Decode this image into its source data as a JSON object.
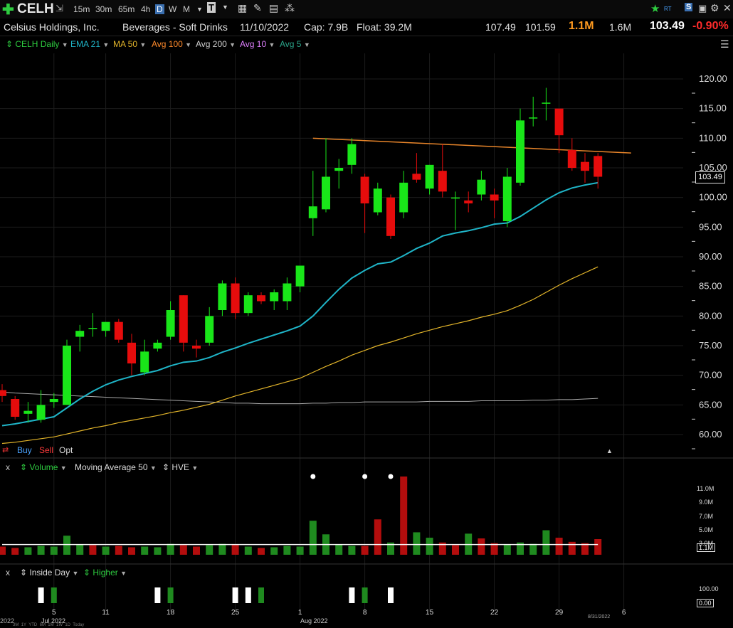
{
  "toolbar": {
    "plus_icon": "plus-icon",
    "symbol": "CELH",
    "timeframes": [
      "15m",
      "30m",
      "65m",
      "4h",
      "D",
      "W",
      "M"
    ],
    "active_timeframe": "D",
    "right_labels": [
      "RT"
    ]
  },
  "info": {
    "company": "Celsius Holdings, Inc.",
    "industry": "Beverages - Soft Drinks",
    "date": "11/10/2022",
    "cap": "Cap: 7.9B",
    "float": "Float: 39.2M",
    "high": "107.49",
    "low": "101.59",
    "volume": "1.1M",
    "avg_volume": "1.6M",
    "last": "103.49",
    "change": "-0.90%"
  },
  "indicators": {
    "symbol_label": "CELH Daily",
    "ema21": "EMA 21",
    "ma50": "MA 50",
    "avg100": "Avg 100",
    "avg200": "Avg 200",
    "avg10": "Avg 10",
    "avg5": "Avg 5"
  },
  "trade": {
    "buy": "Buy",
    "sell": "Sell",
    "opt": "Opt"
  },
  "volume_panel": {
    "close": "x",
    "label": "Volume",
    "ma_label": "Moving Average 50",
    "hve": "HVE",
    "ticks": [
      "11.0M",
      "9.0M",
      "7.0M",
      "5.0M",
      "3.0M"
    ],
    "current": "1.1M"
  },
  "inside_panel": {
    "close": "x",
    "label": "Inside Day",
    "higher": "Higher",
    "ticks": [
      "100.00"
    ],
    "current": "0.00"
  },
  "xaxis": {
    "dates": [
      "5",
      "11",
      "18",
      "25",
      "1",
      "8",
      "15",
      "22",
      "29",
      "6"
    ],
    "months": [
      {
        "label": "Jul 2022",
        "at": "5"
      },
      {
        "label": "Aug 2022",
        "at": "1"
      }
    ],
    "left_fragment": "2022",
    "end_label": "8/31/2022",
    "range_buttons": [
      "3M",
      "1Y",
      "YTD",
      "6M",
      "1M",
      "1W",
      "1D",
      "Today"
    ]
  },
  "colors": {
    "up": "#19e619",
    "down": "#e60c0c",
    "ema21": "#1fb5c8",
    "ma50": "#e3b52a",
    "avg200": "#aaaaaa",
    "trendline": "#e8852a"
  },
  "chart_data": {
    "type": "candlestick",
    "price_axis": {
      "ticks": [
        120,
        115,
        110,
        105,
        100,
        95,
        90,
        85,
        80,
        75,
        70,
        65,
        60
      ],
      "ylim": [
        58,
        122
      ]
    },
    "last_price": "103.49",
    "candles": [
      {
        "d": "Jun 28",
        "o": 67.5,
        "h": 68.5,
        "l": 65.5,
        "c": 66.5
      },
      {
        "d": "Jun 29",
        "o": 66.0,
        "h": 66.5,
        "l": 62.5,
        "c": 63.0
      },
      {
        "d": "Jun 30",
        "o": 63.5,
        "h": 65.5,
        "l": 62.0,
        "c": 64.0
      },
      {
        "d": "Jul 1",
        "o": 62.5,
        "h": 67.5,
        "l": 62.0,
        "c": 65.0
      },
      {
        "d": "Jul 5",
        "o": 65.5,
        "h": 67.0,
        "l": 64.5,
        "c": 66.0
      },
      {
        "d": "Jul 6",
        "o": 65.0,
        "h": 76.0,
        "l": 65.0,
        "c": 75.0
      },
      {
        "d": "Jul 7",
        "o": 76.5,
        "h": 78.5,
        "l": 74.0,
        "c": 77.5
      },
      {
        "d": "Jul 8",
        "o": 78.0,
        "h": 80.5,
        "l": 76.5,
        "c": 78.0
      },
      {
        "d": "Jul 11",
        "o": 77.5,
        "h": 79.0,
        "l": 76.5,
        "c": 79.0
      },
      {
        "d": "Jul 12",
        "o": 79.0,
        "h": 79.5,
        "l": 75.5,
        "c": 76.0
      },
      {
        "d": "Jul 13",
        "o": 75.5,
        "h": 77.0,
        "l": 70.0,
        "c": 72.0
      },
      {
        "d": "Jul 14",
        "o": 70.5,
        "h": 76.0,
        "l": 70.0,
        "c": 74.0
      },
      {
        "d": "Jul 15",
        "o": 74.5,
        "h": 76.0,
        "l": 74.0,
        "c": 75.5
      },
      {
        "d": "Jul 18",
        "o": 76.5,
        "h": 82.5,
        "l": 76.0,
        "c": 81.0
      },
      {
        "d": "Jul 19",
        "o": 83.5,
        "h": 83.5,
        "l": 74.0,
        "c": 75.5
      },
      {
        "d": "Jul 20",
        "o": 75.0,
        "h": 76.0,
        "l": 73.0,
        "c": 74.5
      },
      {
        "d": "Jul 21",
        "o": 75.5,
        "h": 81.5,
        "l": 75.0,
        "c": 80.0
      },
      {
        "d": "Jul 22",
        "o": 81.0,
        "h": 86.0,
        "l": 80.0,
        "c": 85.5
      },
      {
        "d": "Jul 25",
        "o": 85.5,
        "h": 86.5,
        "l": 79.5,
        "c": 80.5
      },
      {
        "d": "Jul 26",
        "o": 80.5,
        "h": 84.0,
        "l": 80.0,
        "c": 83.5
      },
      {
        "d": "Jul 27",
        "o": 83.5,
        "h": 84.0,
        "l": 82.0,
        "c": 82.5
      },
      {
        "d": "Jul 28",
        "o": 82.5,
        "h": 84.5,
        "l": 81.0,
        "c": 84.0
      },
      {
        "d": "Jul 29",
        "o": 82.5,
        "h": 86.5,
        "l": 81.0,
        "c": 85.5
      },
      {
        "d": "Aug 1",
        "o": 85.0,
        "h": 88.5,
        "l": 84.0,
        "c": 88.5
      },
      {
        "d": "Aug 2",
        "o": 96.5,
        "h": 104.5,
        "l": 93.5,
        "c": 98.5
      },
      {
        "d": "Aug 3",
        "o": 98.0,
        "h": 110.0,
        "l": 97.5,
        "c": 103.5
      },
      {
        "d": "Aug 4",
        "o": 104.5,
        "h": 106.5,
        "l": 101.5,
        "c": 105.0
      },
      {
        "d": "Aug 5",
        "o": 105.5,
        "h": 110.0,
        "l": 104.0,
        "c": 109.0
      },
      {
        "d": "Aug 8",
        "o": 103.5,
        "h": 104.0,
        "l": 94.0,
        "c": 99.0
      },
      {
        "d": "Aug 9",
        "o": 97.5,
        "h": 102.5,
        "l": 97.0,
        "c": 101.5
      },
      {
        "d": "Aug 10",
        "o": 100.0,
        "h": 100.5,
        "l": 93.0,
        "c": 93.5
      },
      {
        "d": "Aug 11",
        "o": 97.5,
        "h": 104.5,
        "l": 96.5,
        "c": 102.5
      },
      {
        "d": "Aug 12",
        "o": 104.0,
        "h": 107.5,
        "l": 102.5,
        "c": 103.0
      },
      {
        "d": "Aug 15",
        "o": 101.5,
        "h": 105.5,
        "l": 100.5,
        "c": 105.5
      },
      {
        "d": "Aug 16",
        "o": 104.5,
        "h": 109.0,
        "l": 100.0,
        "c": 101.0
      },
      {
        "d": "Aug 17",
        "o": 100.0,
        "h": 101.0,
        "l": 94.5,
        "c": 100.0
      },
      {
        "d": "Aug 18",
        "o": 99.5,
        "h": 101.0,
        "l": 97.5,
        "c": 99.0
      },
      {
        "d": "Aug 19",
        "o": 100.5,
        "h": 104.5,
        "l": 99.5,
        "c": 103.0
      },
      {
        "d": "Aug 22",
        "o": 100.5,
        "h": 101.5,
        "l": 96.5,
        "c": 99.5
      },
      {
        "d": "Aug 23",
        "o": 96.0,
        "h": 105.0,
        "l": 95.0,
        "c": 103.5
      },
      {
        "d": "Aug 24",
        "o": 102.5,
        "h": 115.0,
        "l": 102.0,
        "c": 113.0
      },
      {
        "d": "Aug 25",
        "o": 113.5,
        "h": 117.0,
        "l": 112.0,
        "c": 113.5
      },
      {
        "d": "Aug 26",
        "o": 116.0,
        "h": 118.5,
        "l": 113.0,
        "c": 116.0
      },
      {
        "d": "Aug 29",
        "o": 115.0,
        "h": 115.0,
        "l": 107.5,
        "c": 110.5
      },
      {
        "d": "Aug 30",
        "o": 108.0,
        "h": 110.0,
        "l": 104.5,
        "c": 105.0
      },
      {
        "d": "Aug 31",
        "o": 106.0,
        "h": 107.5,
        "l": 102.5,
        "c": 104.5
      },
      {
        "d": "Sep 1",
        "o": 107.0,
        "h": 107.5,
        "l": 101.5,
        "c": 103.5
      }
    ],
    "ema21": [
      61.5,
      61.8,
      62.2,
      62.6,
      63.0,
      64.5,
      66.0,
      67.3,
      68.4,
      69.2,
      69.8,
      70.3,
      70.8,
      71.6,
      72.2,
      72.4,
      73.0,
      73.9,
      74.6,
      75.4,
      76.1,
      76.8,
      77.5,
      78.3,
      80.0,
      82.3,
      84.5,
      86.4,
      87.7,
      88.8,
      89.1,
      90.2,
      91.4,
      92.3,
      93.5,
      94.0,
      94.4,
      94.9,
      95.5,
      95.7,
      96.8,
      98.2,
      99.6,
      100.8,
      101.6,
      102.1,
      102.5
    ],
    "ma50": [
      58.5,
      58.7,
      59.0,
      59.3,
      59.6,
      60.1,
      60.6,
      61.1,
      61.5,
      62.0,
      62.4,
      62.8,
      63.2,
      63.7,
      64.1,
      64.6,
      65.1,
      65.8,
      66.5,
      67.1,
      67.7,
      68.3,
      68.9,
      69.5,
      70.5,
      71.5,
      72.4,
      73.4,
      74.2,
      75.0,
      75.6,
      76.3,
      77.0,
      77.6,
      78.2,
      78.7,
      79.2,
      79.8,
      80.3,
      80.9,
      81.8,
      82.8,
      84.0,
      85.2,
      86.3,
      87.3,
      88.3
    ],
    "avg200": [
      67.2,
      67.0,
      66.9,
      66.8,
      66.7,
      66.6,
      66.5,
      66.4,
      66.3,
      66.2,
      66.1,
      66.0,
      65.9,
      65.8,
      65.7,
      65.6,
      65.5,
      65.4,
      65.3,
      65.3,
      65.2,
      65.2,
      65.2,
      65.2,
      65.3,
      65.3,
      65.4,
      65.4,
      65.5,
      65.5,
      65.5,
      65.5,
      65.5,
      65.6,
      65.6,
      65.6,
      65.6,
      65.7,
      65.7,
      65.7,
      65.7,
      65.8,
      65.8,
      65.9,
      65.9,
      66.0,
      66.1
    ],
    "trendline": {
      "from": {
        "d": "Aug 2",
        "y": 110.0
      },
      "to": {
        "d": "Sep 6",
        "y": 107.5
      }
    },
    "volume_ticks": [
      11,
      9,
      7,
      5,
      3
    ],
    "volume": [
      1.2,
      1.0,
      1.1,
      1.3,
      1.2,
      2.8,
      1.5,
      1.4,
      1.2,
      1.3,
      1.1,
      1.2,
      1.1,
      1.6,
      1.4,
      1.2,
      1.4,
      1.6,
      1.5,
      1.2,
      1.0,
      1.1,
      1.3,
      1.2,
      5.0,
      3.0,
      1.5,
      1.3,
      1.3,
      5.2,
      1.8,
      11.5,
      3.3,
      2.5,
      1.8,
      1.4,
      3.1,
      2.4,
      1.7,
      1.5,
      1.8,
      1.6,
      3.6,
      2.5,
      1.9,
      1.7,
      2.3,
      1.5,
      1.3
    ],
    "volume_up": [
      false,
      false,
      true,
      true,
      true,
      true,
      true,
      false,
      true,
      false,
      false,
      true,
      true,
      true,
      false,
      false,
      true,
      true,
      false,
      true,
      false,
      true,
      true,
      true,
      true,
      true,
      true,
      true,
      false,
      false,
      true,
      false,
      true,
      true,
      false,
      false,
      true,
      false,
      false,
      true,
      true,
      true,
      true,
      false,
      false,
      false,
      false
    ],
    "volume_avg": 1.5,
    "hve_dots": [
      "Aug 2",
      "Aug 8",
      "Aug 10"
    ],
    "inside_day": [
      {
        "d": "Jul 1",
        "up": false
      },
      {
        "d": "Jul 5",
        "up": true
      },
      {
        "d": "Jul 15",
        "up": false
      },
      {
        "d": "Jul 18",
        "up": true
      },
      {
        "d": "Jul 25",
        "up": false
      },
      {
        "d": "Jul 26",
        "up": false
      },
      {
        "d": "Jul 27",
        "up": true
      },
      {
        "d": "Aug 5",
        "up": false
      },
      {
        "d": "Aug 8",
        "up": true
      },
      {
        "d": "Aug 10",
        "up": false
      }
    ]
  }
}
